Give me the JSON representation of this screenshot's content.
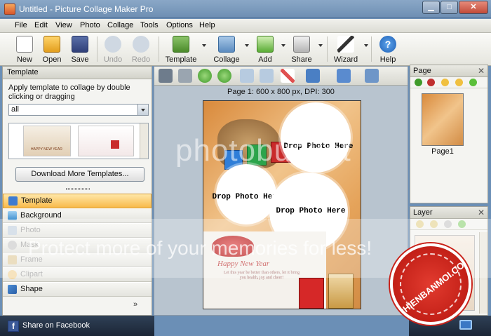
{
  "window": {
    "title": "Untitled - Picture Collage Maker Pro",
    "minimize_symbol": "▁",
    "maximize_symbol": "□",
    "close_symbol": "✕"
  },
  "menu": [
    "File",
    "Edit",
    "View",
    "Photo",
    "Collage",
    "Tools",
    "Options",
    "Help"
  ],
  "toolbar": {
    "new": "New",
    "open": "Open",
    "save": "Save",
    "undo": "Undo",
    "redo": "Redo",
    "template": "Template",
    "collage": "Collage",
    "add": "Add",
    "share": "Share",
    "wizard": "Wizard",
    "help": "Help"
  },
  "template_panel": {
    "title": "Template",
    "hint": "Apply template to collage by double clicking or dragging",
    "filter_value": "all",
    "thumb_caption": "HAPPY NEW YEAR",
    "download_button": "Download More Templates..."
  },
  "nav": {
    "template": "Template",
    "background": "Background",
    "photo": "Photo",
    "mask": "Mask",
    "frame": "Frame",
    "clipart": "Clipart",
    "shape": "Shape",
    "more": "»"
  },
  "facebook": {
    "icon_letter": "f",
    "label": "Share on Facebook"
  },
  "canvas": {
    "caption": "Page 1: 600 x 800 px, DPI: 300",
    "drop_text_1": "Drop Photo Here",
    "drop_text_2": "Drop Photo Here",
    "drop_text_3": "Drop Photo Here",
    "card_title": "Happy New Year",
    "card_subtitle": "Let this year be better than others, let it bring you health, joy and cheer!"
  },
  "page_panel": {
    "title": "Page",
    "close": "✕",
    "page_label": "Page1"
  },
  "layer_panel": {
    "title": "Layer",
    "close": "✕"
  },
  "watermark": {
    "top": "photobucket",
    "bottom": "Protect more of your memories for less!",
    "badge": "PHIENBANMOI.COM"
  },
  "colors": {
    "accent_orange": "#f8b94a",
    "title_blue": "#6e8fb3",
    "status_dark": "#1b2636",
    "badge_red": "#c9221a"
  }
}
